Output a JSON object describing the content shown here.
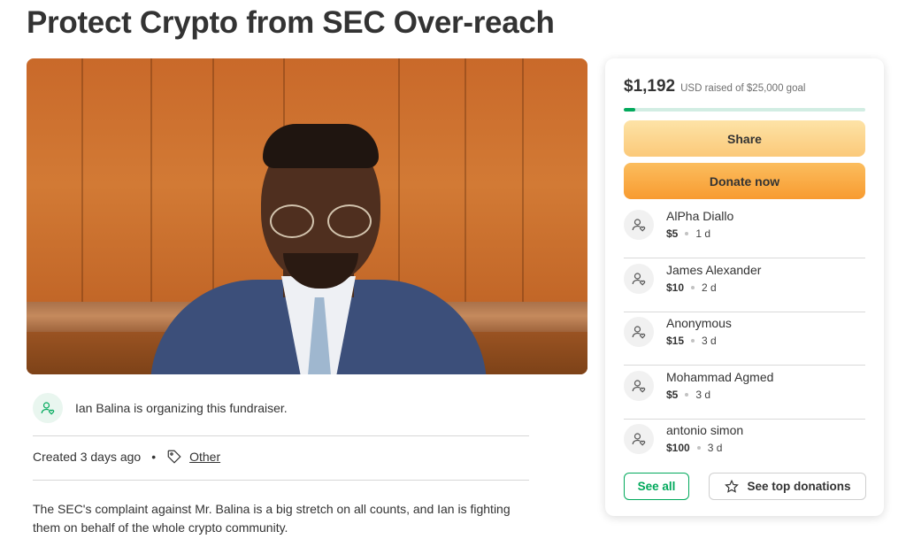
{
  "page": {
    "title": "Protect Crypto from SEC Over-reach"
  },
  "organizer": {
    "text": "Ian Balina is organizing this fundraiser.",
    "icon": "user-heart-icon"
  },
  "meta": {
    "created": "Created 3 days ago",
    "separator": "•",
    "category": "Other",
    "category_icon": "tag-icon"
  },
  "description": "The SEC's complaint against Mr. Balina is a big stretch on all counts, and Ian is fighting them on behalf of the whole crypto community.",
  "campaign": {
    "raised_amount": "$1,192",
    "raised_text": "USD raised of $25,000 goal",
    "progress_fraction": 0.0477,
    "share_label": "Share",
    "donate_label": "Donate now"
  },
  "donations": [
    {
      "name": "AlPha Diallo",
      "amount": "$5",
      "time": "1 d"
    },
    {
      "name": "James Alexander",
      "amount": "$10",
      "time": "2 d"
    },
    {
      "name": "Anonymous",
      "amount": "$15",
      "time": "3 d"
    },
    {
      "name": "Mohammad Agmed",
      "amount": "$5",
      "time": "3 d"
    },
    {
      "name": "antonio simon",
      "amount": "$100",
      "time": "3 d"
    }
  ],
  "actions": {
    "see_all_label": "See all",
    "top_donations_label": "See top donations",
    "top_donations_icon": "star-icon"
  },
  "colors": {
    "accent_green": "#02a95c",
    "share_yellow": "#fbc979",
    "donate_orange": "#f89b30"
  }
}
